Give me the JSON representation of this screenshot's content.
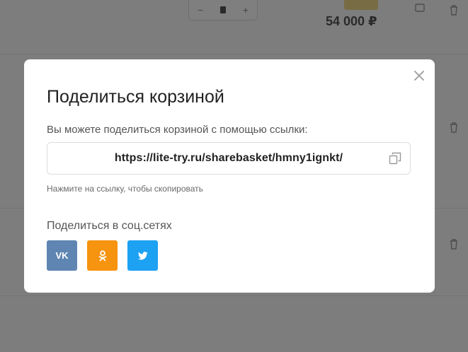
{
  "modal": {
    "title": "Поделиться корзиной",
    "description": "Вы можете поделиться корзиной с помощью ссылки:",
    "share_link": "https://lite-try.ru/sharebasket/hmny1ignkt/",
    "hint": "Нажмите на ссылку, чтобы скопировать",
    "social_title": "Поделиться в соц.сетях",
    "close_icon": "close-icon",
    "copy_icon": "copy-icon",
    "social": [
      {
        "name": "vk",
        "label": "VK",
        "color": "#5f86b3"
      },
      {
        "name": "odnoklassniki",
        "icon": "ok-icon",
        "color": "#f6930f"
      },
      {
        "name": "twitter",
        "icon": "twitter-icon",
        "color": "#1da1f2"
      }
    ]
  },
  "background": {
    "stepper": {
      "minus": "−",
      "plus": "+"
    },
    "price": "54 000 ₽"
  },
  "colors": {
    "overlay": "rgba(0,0,0,0.5)",
    "modal_bg": "#ffffff",
    "text": "#222222"
  }
}
